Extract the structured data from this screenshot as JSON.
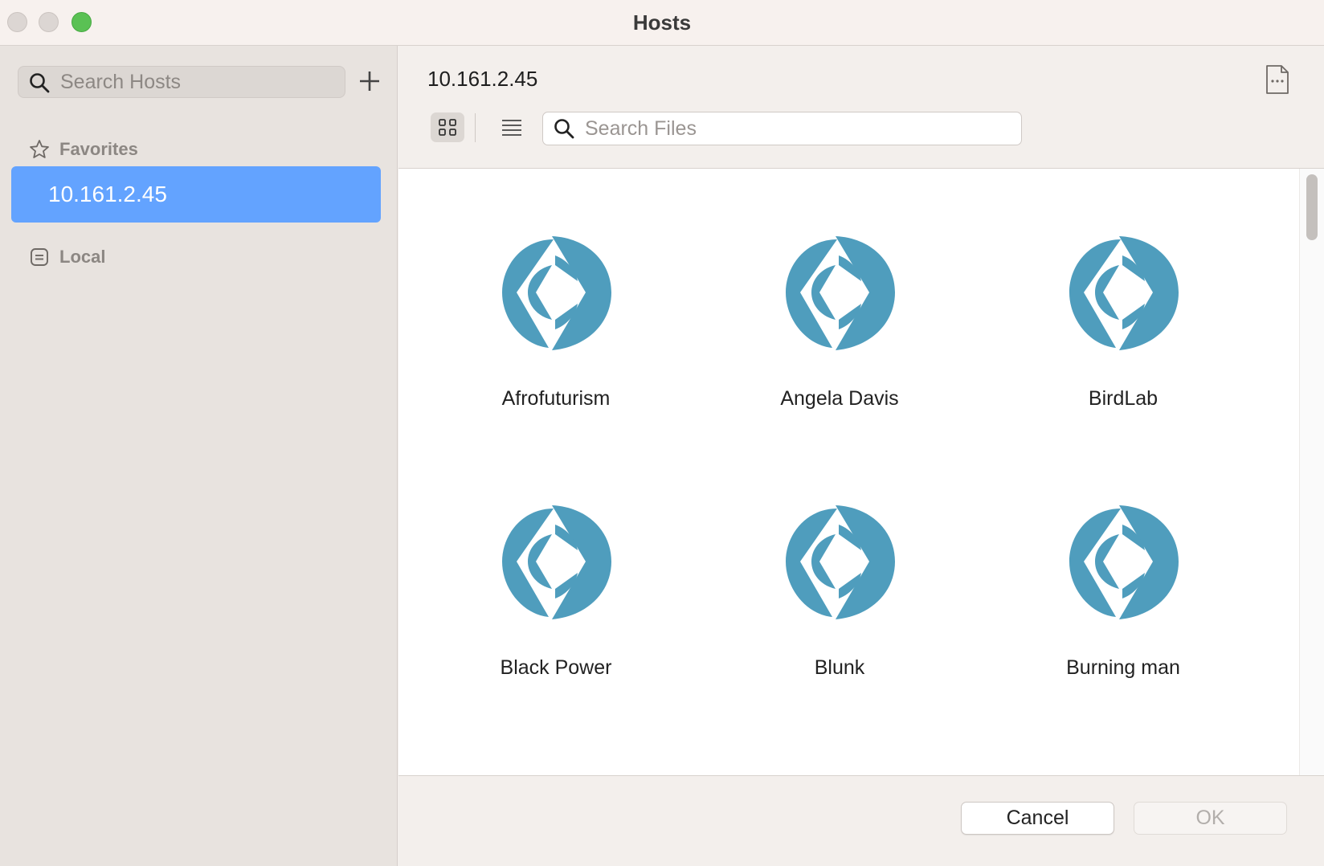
{
  "window": {
    "title": "Hosts"
  },
  "sidebar": {
    "search_placeholder": "Search Hosts",
    "favorites_label": "Favorites",
    "selected_host": "10.161.2.45",
    "local_label": "Local"
  },
  "main": {
    "path_title": "10.161.2.45",
    "search_placeholder": "Search Files",
    "view_mode": "grid",
    "files": [
      {
        "name": "Afrofuturism"
      },
      {
        "name": "Angela Davis"
      },
      {
        "name": "BirdLab"
      },
      {
        "name": "Black Power"
      },
      {
        "name": "Blunk"
      },
      {
        "name": "Burning man"
      }
    ]
  },
  "footer": {
    "cancel_label": "Cancel",
    "ok_label": "OK"
  },
  "colors": {
    "accent": "#63a3ff",
    "file_icon": "#4f9dbd",
    "zoom_button": "#5ac154"
  },
  "icons": {
    "search": "search-icon",
    "add": "plus-icon",
    "favorites": "star-icon",
    "local": "local-drive-icon",
    "more": "document-more-icon",
    "grid_view": "grid-view-icon",
    "list_view": "list-view-icon",
    "file": "filemaker-file-icon"
  }
}
